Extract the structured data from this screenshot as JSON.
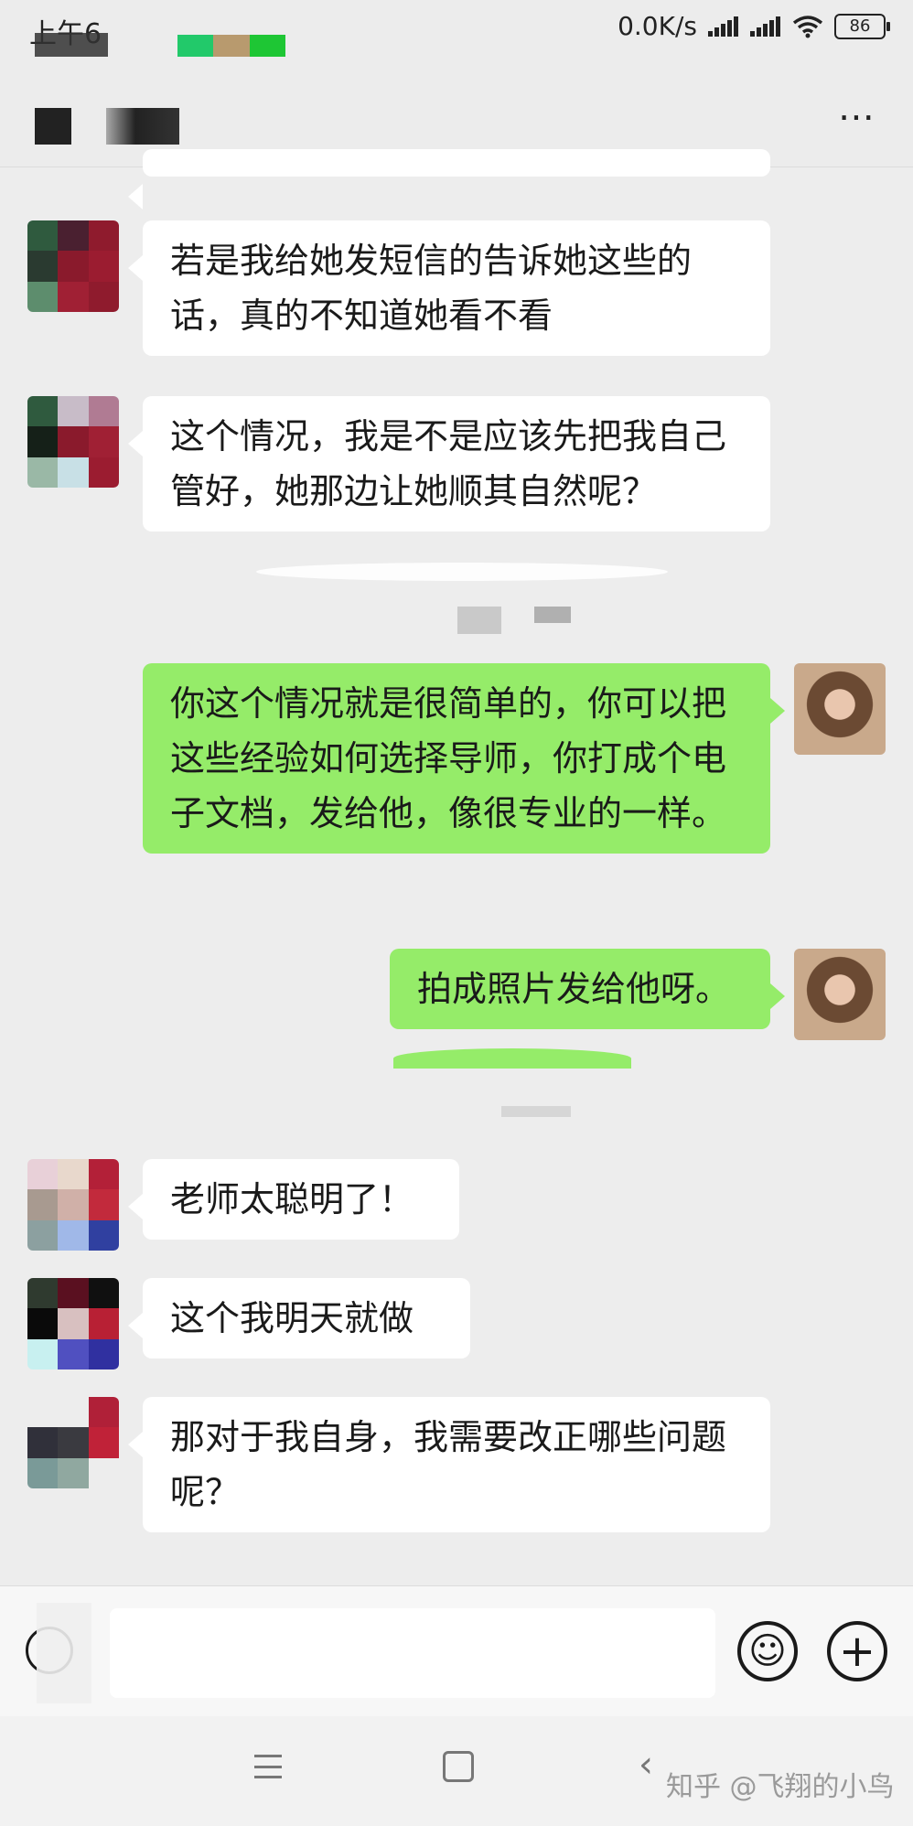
{
  "status_bar": {
    "time": "上午6",
    "network_speed": "0.0K/s",
    "battery": "86"
  },
  "header": {
    "more_icon": "⋯"
  },
  "messages": [
    {
      "side": "in",
      "text": "若是我给她发短信的告诉她这些的话，真的不知道她看不看"
    },
    {
      "side": "in",
      "text": "这个情况，我是不是应该先把我自己管好，她那边让她顺其自然呢？"
    },
    {
      "side": "out",
      "text": "你这个情况就是很简单的，你可以把这些经验如何选择导师，你打成个电子文档，发给他，像很专业的一样。"
    },
    {
      "side": "out",
      "text": "拍成照片发给他呀。"
    },
    {
      "side": "in",
      "text": "老师太聪明了！"
    },
    {
      "side": "in",
      "text": "这个我明天就做"
    },
    {
      "side": "in",
      "text": "那对于我自身，我需要改正哪些问题呢？"
    }
  ],
  "input_bar": {
    "placeholder": "",
    "emoji_icon": "☺",
    "plus_icon": "+"
  },
  "nav": {
    "back_icon": "‹",
    "watermark": "知乎 @飞翔的小鸟"
  },
  "colors": {
    "chat_bg": "#ededed",
    "outgoing_bubble": "#95ec69",
    "incoming_bubble": "#ffffff"
  }
}
